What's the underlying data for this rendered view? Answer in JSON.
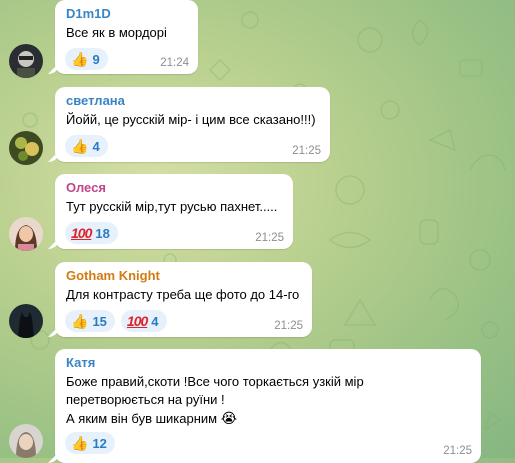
{
  "messages": [
    {
      "author": "D1m1D",
      "author_color": "#3a84c6",
      "lines": [
        "Все як в мордорі"
      ],
      "reactions": [
        {
          "emoji": "thumbs-up",
          "count": "9"
        }
      ],
      "time": "21:24"
    },
    {
      "author": "светлана",
      "author_color": "#3a84c6",
      "lines": [
        "Йойй, це русскій мір- і цим все сказано!!!)"
      ],
      "reactions": [
        {
          "emoji": "thumbs-up",
          "count": "4"
        }
      ],
      "time": "21:25"
    },
    {
      "author": "Олеся",
      "author_color": "#c0458a",
      "lines": [
        "Тут русскій мір,тут русью пахнет....."
      ],
      "reactions": [
        {
          "emoji": "hundred-points",
          "count": "18"
        }
      ],
      "time": "21:25"
    },
    {
      "author": "Gotham Knight",
      "author_color": "#d47a12",
      "lines": [
        "Для контрасту треба ще фото до 14-го"
      ],
      "reactions": [
        {
          "emoji": "thumbs-up",
          "count": "15"
        },
        {
          "emoji": "hundred-points",
          "count": "4"
        }
      ],
      "time": "21:25"
    },
    {
      "author": "Катя",
      "author_color": "#3a84c6",
      "lines": [
        "Боже правий,скоти !Все чого торкається узкій мір",
        "перетворюється на руїни !",
        "А яким він був шикарним"
      ],
      "reactions": [
        {
          "emoji": "thumbs-up",
          "count": "12"
        }
      ],
      "time": "21:25"
    }
  ],
  "colors": {
    "reaction_bg": "#e6f1fb",
    "reaction_text": "#2a7bc4",
    "time": "#8a8f94"
  }
}
